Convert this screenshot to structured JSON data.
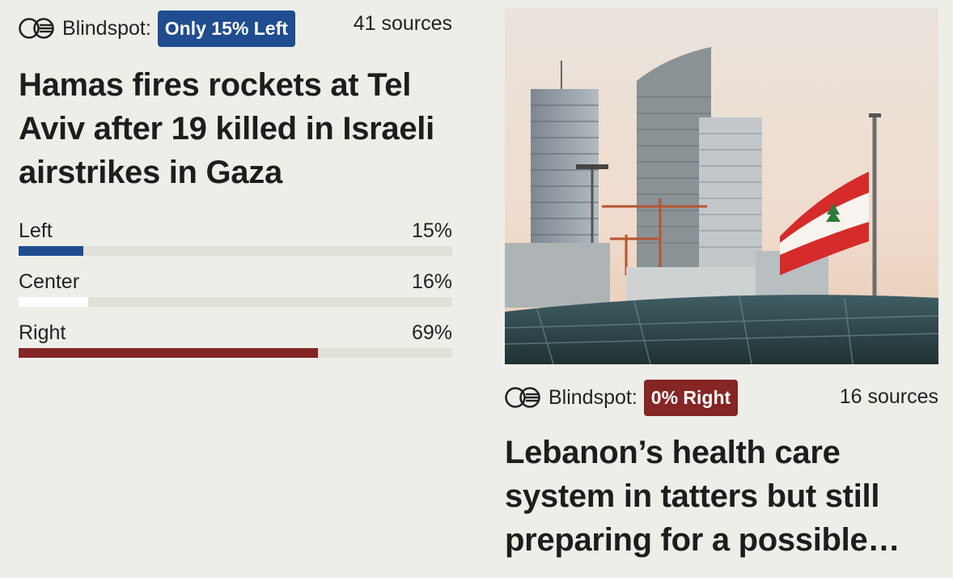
{
  "colors": {
    "left": "#1f4d8f",
    "center": "#ffffff",
    "right": "#852525",
    "track": "#e1e1d9",
    "background": "#eeeee9"
  },
  "stories": [
    {
      "blindspot_label": "Blindspot:",
      "badge": "Only 15% Left",
      "badge_color": "#1f4d8f",
      "sources": "41 sources",
      "headline": "Hamas fires rockets at Tel Aviv after 19 killed in Israeli airstrikes in Gaza",
      "bias": [
        {
          "label": "Left",
          "percent_text": "15%",
          "percent": 15
        },
        {
          "label": "Center",
          "percent_text": "16%",
          "percent": 16
        },
        {
          "label": "Right",
          "percent_text": "69%",
          "percent": 69
        }
      ]
    },
    {
      "blindspot_label": "Blindspot:",
      "badge": "0% Right",
      "badge_color": "#852525",
      "sources": "16 sources",
      "headline": "Lebanon’s health care system in tatters but still preparing for a possible…",
      "image_icon": "lebanon-skyline-flag-image"
    }
  ]
}
